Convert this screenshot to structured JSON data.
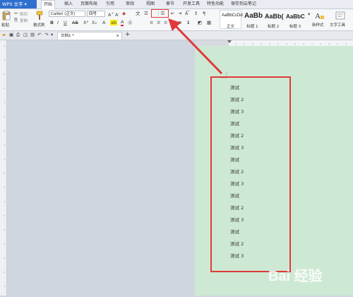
{
  "app": {
    "name": "WPS 文字",
    "dropdown_arrow": "▾"
  },
  "menu": [
    "开始",
    "插入",
    "页面布局",
    "引用",
    "审阅",
    "视图",
    "章节",
    "开发工具",
    "特色功能",
    "保存到云笔记"
  ],
  "ribbon": {
    "paste_label": "粘贴",
    "cut_label": "剪切",
    "copy_label": "复制",
    "format_painter_label": "格式刷",
    "font_name": "Calibri (正文)",
    "font_size": "四号",
    "styles": [
      {
        "sample": "AaBbCcDd",
        "name": "正文"
      },
      {
        "sample": "AaBb",
        "name": "标题 1"
      },
      {
        "sample": "AaBb(",
        "name": "标题 2"
      },
      {
        "sample": "AaBbC",
        "name": "标题 3"
      }
    ],
    "new_style_label": "新样式",
    "text_tools_label": "文字工具"
  },
  "tabs": {
    "doc_tab_label": "文档1 *",
    "add_tab": "+"
  },
  "document": {
    "lines": [
      "测试",
      "测试 2",
      "测试 3",
      "测试",
      "测试 2",
      "测试 3",
      "测试",
      "测试 2",
      "测试 3",
      "测试",
      "测试 2",
      "测试 3",
      "测试",
      "测试 2",
      "测试 3"
    ]
  },
  "watermark": {
    "text": "Bai 经验"
  },
  "colors": {
    "annotation_red": "#e03a3a",
    "page_green": "#cde9d3",
    "wps_blue": "#2f6fce"
  }
}
